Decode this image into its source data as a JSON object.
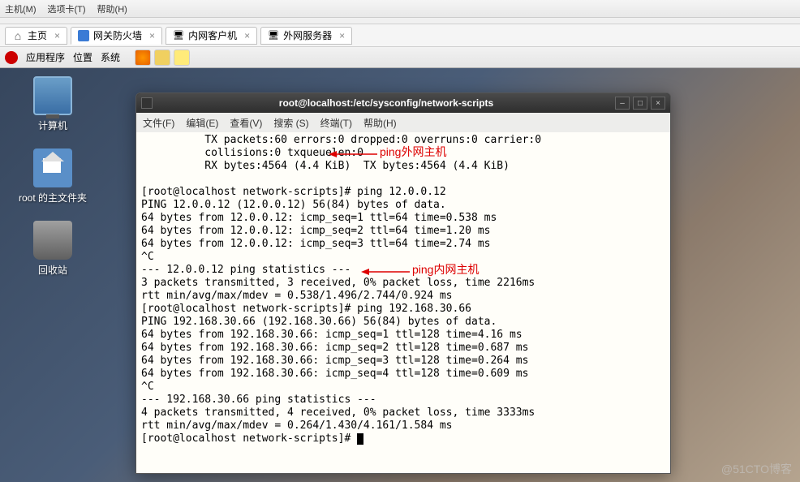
{
  "top_menu": {
    "items": [
      "主机(M)",
      "选项卡(T)",
      "帮助(H)"
    ]
  },
  "tabs": [
    {
      "label": "主页",
      "icon": "home-icon",
      "active": false,
      "closable": true
    },
    {
      "label": "网关防火墙",
      "icon": "shield-icon",
      "active": true,
      "closable": true
    },
    {
      "label": "内网客户机",
      "icon": "monitor-icon",
      "active": false,
      "closable": true
    },
    {
      "label": "外网服务器",
      "icon": "monitor-icon",
      "active": false,
      "closable": true
    }
  ],
  "gnome_panel": {
    "apps": "应用程序",
    "location": "位置",
    "system": "系统"
  },
  "desktop_icons": {
    "computer": "计算机",
    "home": "root 的主文件夹",
    "trash": "回收站"
  },
  "terminal": {
    "title": "root@localhost:/etc/sysconfig/network-scripts",
    "menu": {
      "file": "文件(F)",
      "edit": "编辑(E)",
      "view": "查看(V)",
      "search": "搜索 (S)",
      "terminal": "终端(T)",
      "help": "帮助(H)"
    },
    "lines": [
      "          TX packets:60 errors:0 dropped:0 overruns:0 carrier:0",
      "          collisions:0 txqueuelen:0",
      "          RX bytes:4564 (4.4 KiB)  TX bytes:4564 (4.4 KiB)",
      "",
      "[root@localhost network-scripts]# ping 12.0.0.12",
      "PING 12.0.0.12 (12.0.0.12) 56(84) bytes of data.",
      "64 bytes from 12.0.0.12: icmp_seq=1 ttl=64 time=0.538 ms",
      "64 bytes from 12.0.0.12: icmp_seq=2 ttl=64 time=1.20 ms",
      "64 bytes from 12.0.0.12: icmp_seq=3 ttl=64 time=2.74 ms",
      "^C",
      "--- 12.0.0.12 ping statistics ---",
      "3 packets transmitted, 3 received, 0% packet loss, time 2216ms",
      "rtt min/avg/max/mdev = 0.538/1.496/2.744/0.924 ms",
      "[root@localhost network-scripts]# ping 192.168.30.66",
      "PING 192.168.30.66 (192.168.30.66) 56(84) bytes of data.",
      "64 bytes from 192.168.30.66: icmp_seq=1 ttl=128 time=4.16 ms",
      "64 bytes from 192.168.30.66: icmp_seq=2 ttl=128 time=0.687 ms",
      "64 bytes from 192.168.30.66: icmp_seq=3 ttl=128 time=0.264 ms",
      "64 bytes from 192.168.30.66: icmp_seq=4 ttl=128 time=0.609 ms",
      "^C",
      "--- 192.168.30.66 ping statistics ---",
      "4 packets transmitted, 4 received, 0% packet loss, time 3333ms",
      "rtt min/avg/max/mdev = 0.264/1.430/4.161/1.584 ms",
      "[root@localhost network-scripts]# "
    ]
  },
  "annotations": {
    "external": "ping外网主机",
    "internal": "ping内网主机"
  },
  "watermark": "@51CTO博客"
}
